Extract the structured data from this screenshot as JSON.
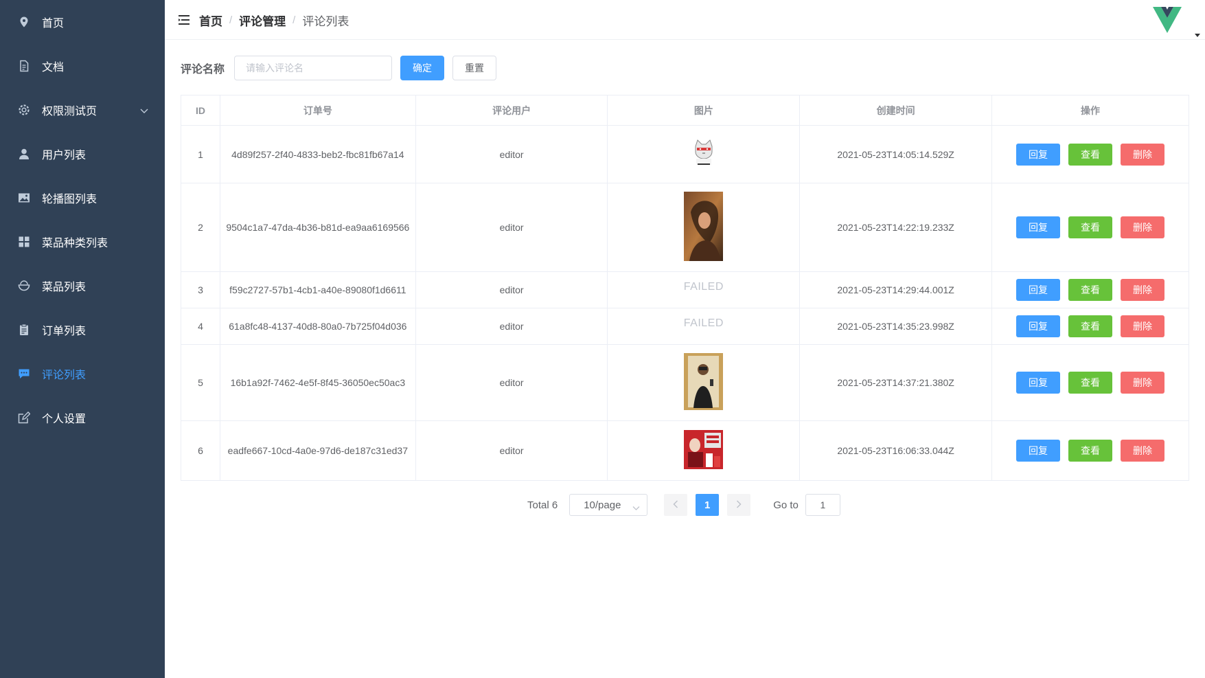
{
  "sidebar": {
    "items": [
      {
        "label": "首页",
        "icon": "location-pin-icon"
      },
      {
        "label": "文档",
        "icon": "document-icon"
      },
      {
        "label": "权限测试页",
        "icon": "gear-icon"
      },
      {
        "label": "用户列表",
        "icon": "user-icon"
      },
      {
        "label": "轮播图列表",
        "icon": "picture-icon"
      },
      {
        "label": "菜品种类列表",
        "icon": "grid-icon"
      },
      {
        "label": "菜品列表",
        "icon": "bowl-icon"
      },
      {
        "label": "订单列表",
        "icon": "clipboard-icon"
      },
      {
        "label": "评论列表",
        "icon": "chat-icon"
      },
      {
        "label": "个人设置",
        "icon": "edit-icon"
      }
    ],
    "active": "评论列表",
    "colors": {
      "background": "#304156",
      "text": "#ffffff",
      "active": "#409eff"
    }
  },
  "breadcrumb": {
    "home": "首页",
    "section": "评论管理",
    "current": "评论列表",
    "separator": "/"
  },
  "filter": {
    "label": "评论名称",
    "placeholder": "请输入评论名",
    "value": "",
    "confirm_label": "确定",
    "reset_label": "重置"
  },
  "table": {
    "headers": {
      "id": "ID",
      "order": "订单号",
      "user": "评论用户",
      "image": "图片",
      "time": "创建时间",
      "ops": "操作"
    },
    "rows": [
      {
        "id": "1",
        "order": "4d89f257-2f40-4833-beb2-fbc81fb67a14",
        "user": "editor",
        "image": "cat-sticker",
        "time": "2021-05-23T14:05:14.529Z"
      },
      {
        "id": "2",
        "order": "9504c1a7-47da-4b36-b81d-ea9aa6169566",
        "user": "editor",
        "image": "portrait-photo",
        "time": "2021-05-23T14:22:19.233Z"
      },
      {
        "id": "3",
        "order": "f59c2727-57b1-4cb1-a40e-89080f1d6611",
        "user": "editor",
        "image_failed": "FAILED",
        "time": "2021-05-23T14:29:44.001Z"
      },
      {
        "id": "4",
        "order": "61a8fc48-4137-40d8-80a0-7b725f04d036",
        "user": "editor",
        "image_failed": "FAILED",
        "time": "2021-05-23T14:35:23.998Z"
      },
      {
        "id": "5",
        "order": "16b1a92f-7462-4e5f-8f45-36050ec50ac3",
        "user": "editor",
        "image": "mirror-selfie-photo",
        "time": "2021-05-23T14:37:21.380Z"
      },
      {
        "id": "6",
        "order": "eadfe667-10cd-4a0e-97d6-de187c31ed37",
        "user": "editor",
        "image": "milk-drink-photo",
        "time": "2021-05-23T16:06:33.044Z"
      }
    ],
    "actions": {
      "reply": "回复",
      "view": "查看",
      "delete": "删除"
    }
  },
  "pagination": {
    "total_label": "Total 6",
    "page_size": "10/page",
    "current_page": "1",
    "goto_label": "Go to",
    "goto_value": "1"
  },
  "colors": {
    "primary": "#409eff",
    "success": "#67c23a",
    "danger": "#f56c6c"
  }
}
